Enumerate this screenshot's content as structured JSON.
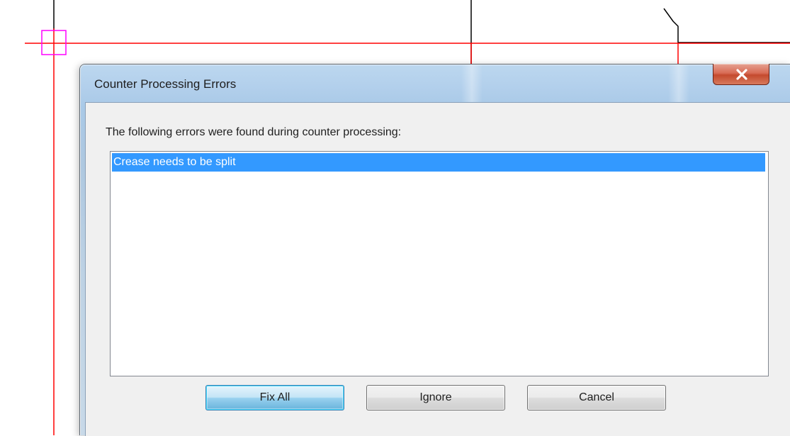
{
  "dialog": {
    "title": "Counter Processing Errors",
    "prompt": "The following errors were found during counter processing:",
    "errors": [
      "Crease needs to be split"
    ],
    "buttons": {
      "fix_all": "Fix All",
      "ignore": "Ignore",
      "cancel": "Cancel"
    },
    "close_icon": "close-icon"
  },
  "colors": {
    "guide_line": "#ff0000",
    "selection_marker": "#ff00ff",
    "edge_line": "#000000",
    "list_selection": "#3399ff",
    "close_button": "#c44a2e"
  }
}
